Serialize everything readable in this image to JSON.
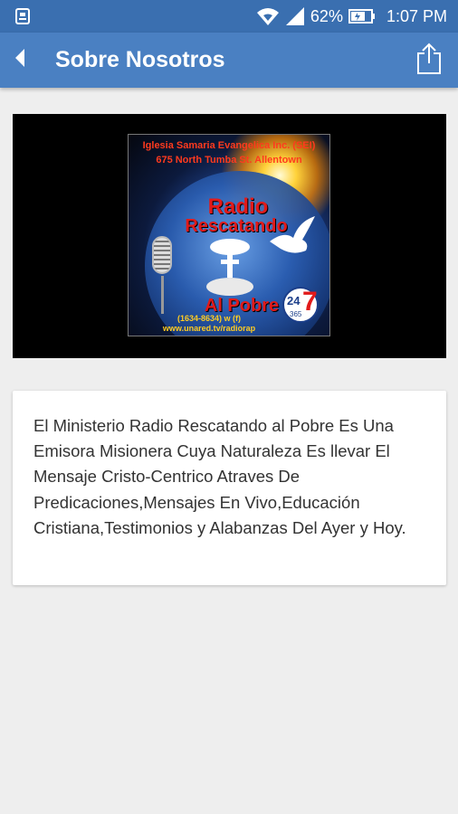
{
  "status_bar": {
    "battery_percent": "62%",
    "time": "1:07 PM",
    "icons": [
      "notification-icon",
      "wifi-icon",
      "signal-icon",
      "battery-icon"
    ]
  },
  "app_bar": {
    "title": "Sobre Nosotros",
    "back_icon": "back-arrow-icon",
    "share_icon": "share-icon",
    "color": "#4a80c2"
  },
  "logo": {
    "line1": "Iglesia Samaria Evangelica Inc. (SEI)",
    "line2": "675 North Tumba St. Allentown",
    "title1": "Radio",
    "title2": "Rescatando",
    "title3": "Al Pobre",
    "freq": "(1634-8634) w (f)",
    "url": "www.unared.tv/radiorap",
    "badge_big": "24",
    "badge_num": "7",
    "badge_small": "365"
  },
  "about": {
    "text": "El Ministerio Radio Rescatando al Pobre Es Una Emisora Misionera Cuya Naturaleza Es llevar El Mensaje Cristo-Centrico Atraves De Predicaciones,Mensajes En Vivo,Educación Cristiana,Testimonios y Alabanzas Del Ayer y Hoy."
  }
}
